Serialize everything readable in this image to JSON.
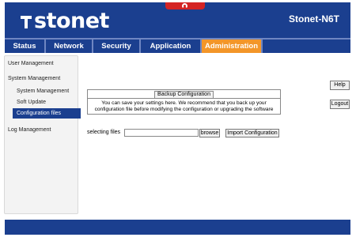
{
  "header": {
    "brand": "stonet",
    "model": "Stonet-N6T"
  },
  "nav": {
    "items": [
      {
        "label": "Status",
        "active": false
      },
      {
        "label": "Network",
        "active": false
      },
      {
        "label": "Security",
        "active": false
      },
      {
        "label": "Application",
        "active": false
      },
      {
        "label": "Administration",
        "active": true
      }
    ]
  },
  "sidebar": {
    "user_management": "User Management",
    "system_management": "System Management",
    "sub_system_management": "System Management",
    "soft_update": "Soft Update",
    "configuration_files": "Configuration files",
    "log_management": "Log Management"
  },
  "main": {
    "backup_title": "Backup Configuration",
    "backup_desc_line1": "You can save your settings here. We recommend that you back up your",
    "backup_desc_line2": "configuration file before modifying the configuration or upgrading the software",
    "selecting_files_label": "selecting files",
    "file_value": "",
    "browse_label": "browse",
    "import_label": "Import Configuration"
  },
  "side_buttons": {
    "help": "Help",
    "logout": "Logout"
  },
  "colors": {
    "brand_blue": "#1b3f8f",
    "active_orange": "#f39629",
    "top_red": "#d42424"
  }
}
